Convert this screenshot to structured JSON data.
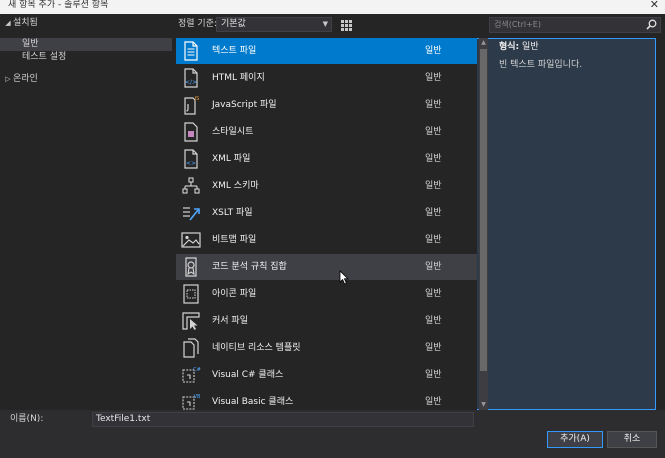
{
  "window": {
    "title": "새 항목 추가 - 솔루션 항목"
  },
  "tree": [
    {
      "label": "설치됨",
      "expanded": true,
      "indent": 0
    },
    {
      "label": "일반",
      "indent": 1,
      "selected": true
    },
    {
      "label": "테스트 설정",
      "indent": 1
    },
    {
      "label": "온라인",
      "expanded": false,
      "indent": 0
    }
  ],
  "toolbar": {
    "sort_label": "정렬 기준:",
    "sort_value": "기본값"
  },
  "items": [
    {
      "name": "텍스트 파일",
      "category": "일반",
      "icon": "text-file-icon",
      "state": "selected"
    },
    {
      "name": "HTML 페이지",
      "category": "일반",
      "icon": "html-page-icon"
    },
    {
      "name": "JavaScript 파일",
      "category": "일반",
      "icon": "javascript-file-icon"
    },
    {
      "name": "스타일시트",
      "category": "일반",
      "icon": "stylesheet-icon"
    },
    {
      "name": "XML 파일",
      "category": "일반",
      "icon": "xml-file-icon"
    },
    {
      "name": "XML 스키마",
      "category": "일반",
      "icon": "xml-schema-icon"
    },
    {
      "name": "XSLT 파일",
      "category": "일반",
      "icon": "xslt-file-icon"
    },
    {
      "name": "비트맵 파일",
      "category": "일반",
      "icon": "bitmap-file-icon"
    },
    {
      "name": "코드 분석 규칙 집합",
      "category": "일반",
      "icon": "code-analysis-ruleset-icon",
      "state": "hover"
    },
    {
      "name": "아이콘 파일",
      "category": "일반",
      "icon": "icon-file-icon"
    },
    {
      "name": "커서 파일",
      "category": "일반",
      "icon": "cursor-file-icon"
    },
    {
      "name": "네이티브 리소스 템플릿",
      "category": "일반",
      "icon": "native-resource-template-icon"
    },
    {
      "name": "Visual C# 클래스",
      "category": "일반",
      "icon": "csharp-class-icon"
    },
    {
      "name": "Visual Basic 클래스",
      "category": "일반",
      "icon": "vb-class-icon"
    }
  ],
  "search": {
    "placeholder": "검색(Ctrl+E)"
  },
  "details": {
    "type_label": "형식:",
    "type_value": "일반",
    "description": "빈 텍스트 파일입니다."
  },
  "footer": {
    "name_label": "이름(N):",
    "name_value": "TextFile1.txt",
    "add_button": "추가(A)",
    "cancel_button": "취소"
  },
  "colors": {
    "accent": "#007acc",
    "background": "#252526",
    "hover": "#3f3f46"
  }
}
